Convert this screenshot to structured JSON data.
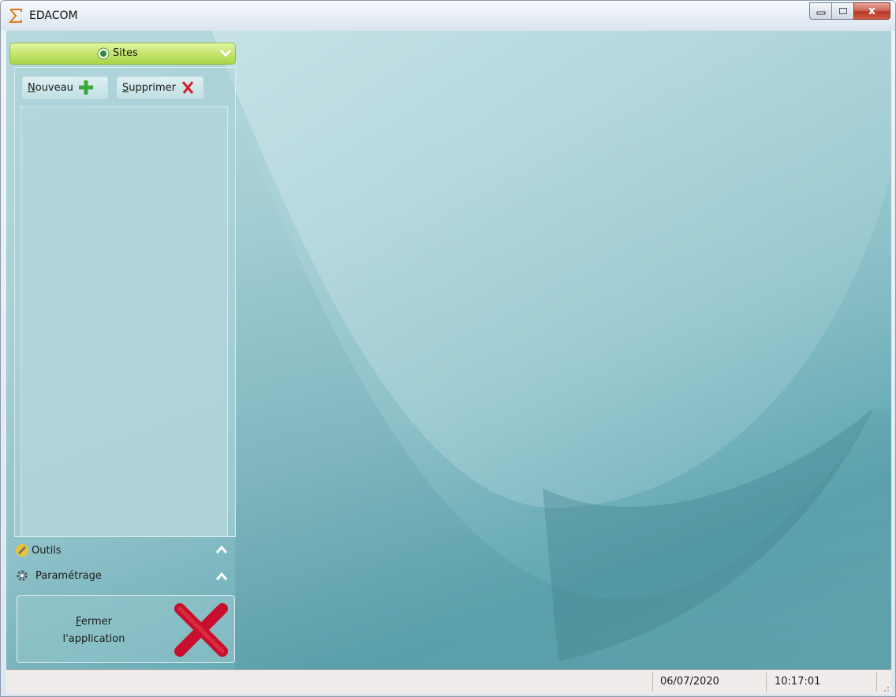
{
  "window": {
    "title": "EDACOM",
    "controls": [
      "minimize",
      "maximize",
      "close"
    ],
    "close_glyph": "x"
  },
  "sidebar": {
    "header": {
      "label": "Sites",
      "icon": "globe-icon",
      "expanded": true
    },
    "toolbar": {
      "new_label": "Nouveau",
      "new_accel": "N",
      "delete_label": "Supprimer",
      "delete_accel": "S"
    },
    "sections": [
      {
        "label": "Outils",
        "icon": "tools-icon",
        "expanded": false
      },
      {
        "label": "Paramétrage",
        "icon": "gear-icon",
        "expanded": false
      }
    ],
    "close_app": {
      "line1": "Fermer",
      "line1_accel": "F",
      "line2": "l'application"
    }
  },
  "statusbar": {
    "date": "06/07/2020",
    "time": "10:17:01"
  },
  "colors": {
    "accent_green": "#a9d54a",
    "background_teal": "#6aa9b3",
    "close_red": "#c8102e"
  }
}
